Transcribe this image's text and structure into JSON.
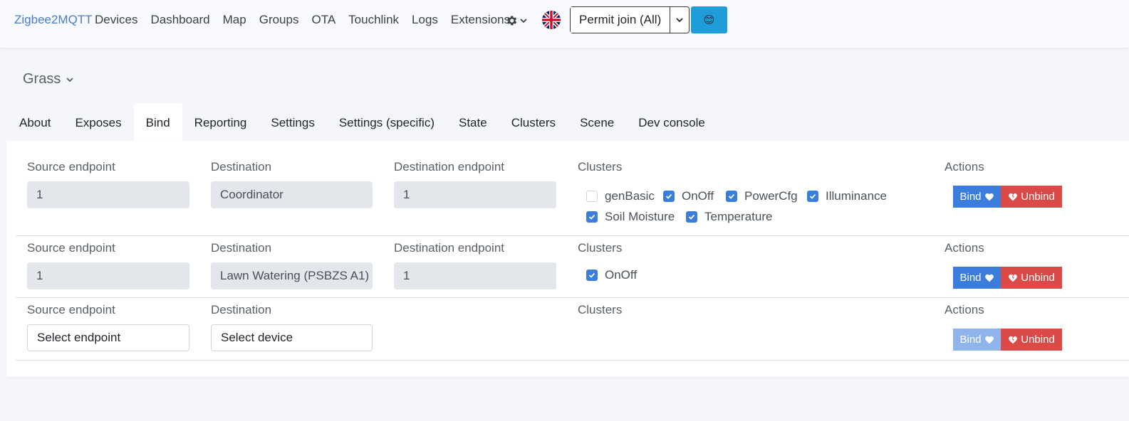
{
  "navbar": {
    "brand": "Zigbee2MQTT",
    "links": [
      "Devices",
      "Dashboard",
      "Map",
      "Groups",
      "OTA",
      "Touchlink",
      "Logs",
      "Extensions"
    ],
    "permit_label": "Permit join (All)",
    "smile_icon": "😊"
  },
  "device": {
    "name": "Grass"
  },
  "tabs": [
    "About",
    "Exposes",
    "Bind",
    "Reporting",
    "Settings",
    "Settings (specific)",
    "State",
    "Clusters",
    "Scene",
    "Dev console"
  ],
  "bind_rows": [
    {
      "source_label": "Source endpoint",
      "source_value": "1",
      "destination_label": "Destination",
      "destination_value": "Coordinator",
      "dest_endpoint_label": "Destination endpoint",
      "dest_endpoint_value": "1",
      "clusters_label": "Clusters",
      "clusters": [
        {
          "name": "genBasic",
          "checked": false
        },
        {
          "name": "OnOff",
          "checked": true
        },
        {
          "name": "PowerCfg",
          "checked": true
        },
        {
          "name": "Illuminance",
          "checked": true
        },
        {
          "name": "Soil Moisture",
          "checked": true
        },
        {
          "name": "Temperature",
          "checked": true
        }
      ],
      "actions_label": "Actions",
      "bind_label": "Bind",
      "unbind_label": "Unbind"
    },
    {
      "source_label": "Source endpoint",
      "source_value": "1",
      "destination_label": "Destination",
      "destination_value": "Lawn Watering (PSBZS A1)",
      "dest_endpoint_label": "Destination endpoint",
      "dest_endpoint_value": "1",
      "clusters_label": "Clusters",
      "clusters": [
        {
          "name": "OnOff",
          "checked": true
        }
      ],
      "actions_label": "Actions",
      "bind_label": "Bind",
      "unbind_label": "Unbind"
    },
    {
      "source_label": "Source endpoint",
      "source_placeholder": "Select endpoint",
      "destination_label": "Destination",
      "destination_placeholder": "Select device",
      "clusters_label": "Clusters",
      "actions_label": "Actions",
      "bind_label": "Bind",
      "unbind_label": "Unbind"
    }
  ],
  "colors": {
    "brand": "#4a7dc7",
    "primary": "#3b7ddd",
    "danger": "#dc4a48",
    "info": "#1e9dd8"
  }
}
